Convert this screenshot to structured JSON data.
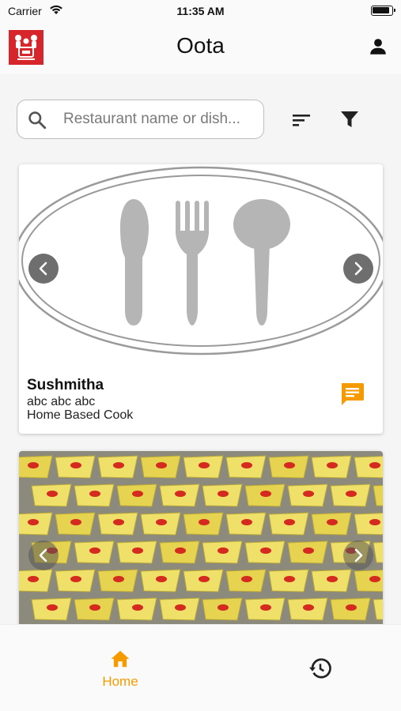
{
  "status_bar": {
    "carrier": "Carrier",
    "time": "11:35 AM"
  },
  "app_bar": {
    "title": "Oota"
  },
  "search": {
    "placeholder": "Restaurant name or dish..."
  },
  "icons": {
    "logo": "oota-logo",
    "profile": "person-icon",
    "search": "search-icon",
    "sort": "sort-icon",
    "filter": "filter-icon",
    "chat": "chat-icon",
    "home": "home-icon",
    "history": "history-icon"
  },
  "listings": [
    {
      "name": "Sushmitha",
      "subtitle": "abc abc abc",
      "type": "Home Based Cook",
      "image": "cutlery-placeholder"
    },
    {
      "image": "dish-photo"
    }
  ],
  "bottom_nav": {
    "items": [
      {
        "label": "Home",
        "icon": "home-icon",
        "active": true
      },
      {
        "label": "",
        "icon": "history-icon",
        "active": false
      }
    ]
  },
  "colors": {
    "accent": "#f59b00",
    "logo_red": "#d6262b",
    "placeholder_grey": "#b5b5b5"
  }
}
